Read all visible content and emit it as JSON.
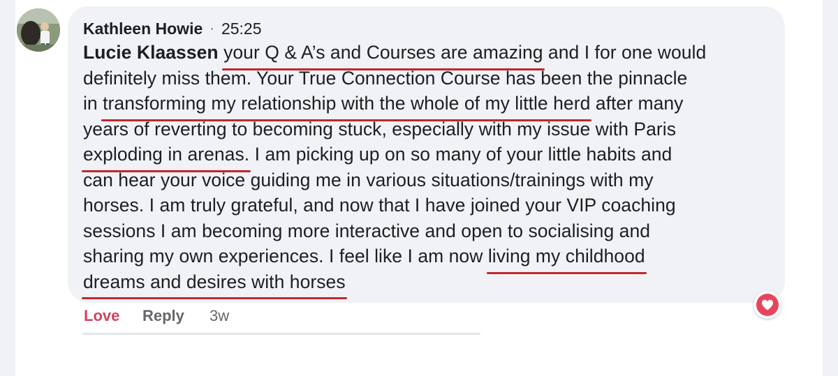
{
  "comment": {
    "author": "Kathleen Howie",
    "separator": "·",
    "timestamp": "25:25",
    "mention": "Lucie Klaassen",
    "lines": [
      {
        "segments": [
          {
            "text": " "
          },
          {
            "text": "your Q & A’s and Courses are amazing",
            "underline": true
          },
          {
            "text": " and I for one would"
          }
        ]
      },
      {
        "segments": [
          {
            "text": "definitely miss them. Your True Connection Course has been the pinnacle"
          }
        ]
      },
      {
        "segments": [
          {
            "text": "in "
          },
          {
            "text": "transforming my relationship with the whole of my little herd",
            "underline": true
          },
          {
            "text": " after many"
          }
        ]
      },
      {
        "segments": [
          {
            "text": "years of reverting to becoming stuck, especially with my issue with Paris"
          }
        ]
      },
      {
        "segments": [
          {
            "text": "exploding in arenas.",
            "underline": true
          },
          {
            "text": " I am picking up on so many of your little habits and"
          }
        ]
      },
      {
        "segments": [
          {
            "text": "can hear your voice guiding me in various situations/trainings with my"
          }
        ]
      },
      {
        "segments": [
          {
            "text": "horses. I am truly grateful, and now that I have joined your VIP coaching"
          }
        ]
      },
      {
        "segments": [
          {
            "text": "sessions I am becoming more interactive and open to socialising and"
          }
        ]
      },
      {
        "segments": [
          {
            "text": "sharing my own experiences. I feel like I am now "
          },
          {
            "text": "living my childhood",
            "underline": true
          }
        ]
      },
      {
        "segments": [
          {
            "text": "dreams and desires with horses",
            "underline": true
          }
        ]
      }
    ]
  },
  "actions": {
    "love_label": "Love",
    "reply_label": "Reply",
    "age": "3w"
  },
  "reaction": {
    "icon": "heart-icon",
    "color": "#e8455d"
  },
  "colors": {
    "accent_love": "#d4435a",
    "underline": "#c1272d",
    "bubble": "#f0f2f5"
  }
}
